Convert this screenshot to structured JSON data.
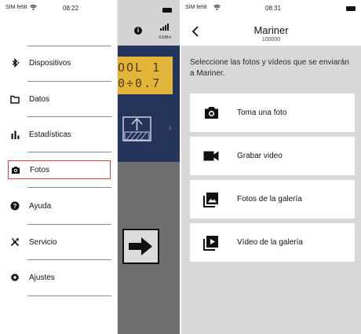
{
  "left_screen": {
    "status_bar": {
      "carrier": "SIM fehlt",
      "time": "08:22"
    },
    "background_app": {
      "lcd_line_1": "OOL 1",
      "lcd_line_2": "0÷0.7",
      "signal_text": "-63dBm"
    },
    "menu": [
      {
        "label": "Dispositivos",
        "icon": "bluetooth-icon",
        "active": false
      },
      {
        "label": "Datos",
        "icon": "folder-icon",
        "active": false
      },
      {
        "label": "Estadísticas",
        "icon": "bar-chart-icon",
        "active": false
      },
      {
        "label": "Fotos",
        "icon": "camera-icon",
        "active": true
      },
      {
        "label": "Ayuda",
        "icon": "help-icon",
        "active": false
      },
      {
        "label": "Servicio",
        "icon": "tools-icon",
        "active": false
      },
      {
        "label": "Ajustes",
        "icon": "settings-icon",
        "active": false
      }
    ],
    "active_highlight_color": "#e03a3a"
  },
  "right_screen": {
    "status_bar": {
      "carrier": "SIM fehlt",
      "time": "08:31"
    },
    "header": {
      "title": "Mariner",
      "subtitle": "100000"
    },
    "instructions": "Seleccione las fotos y vídeos que se enviarán a Mariner.",
    "options": [
      {
        "label": "Toma una foto",
        "icon": "camera-icon"
      },
      {
        "label": "Grabar video",
        "icon": "video-camera-icon"
      },
      {
        "label": "Fotos de la galería",
        "icon": "photo-library-icon"
      },
      {
        "label": "Vídeo de la galería",
        "icon": "video-library-icon"
      }
    ]
  }
}
